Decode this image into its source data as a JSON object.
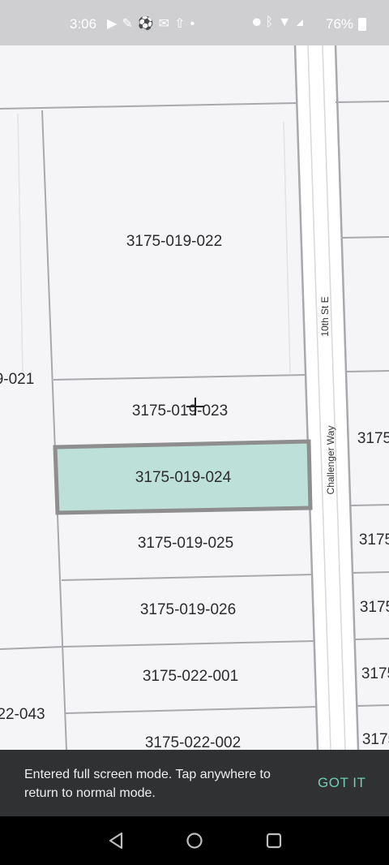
{
  "status_bar": {
    "time": "3:06",
    "left_icons": [
      "youtube-icon",
      "feed-icon",
      "game-icon",
      "mail-icon",
      "upload-icon",
      "dot-icon"
    ],
    "right_icons": [
      "location-icon",
      "bluetooth-icon",
      "wifi-icon",
      "signal-icon"
    ],
    "battery": "76%"
  },
  "map": {
    "parcels": [
      "3175-019-022",
      "3175-019-023",
      "3175-019-024",
      "3175-019-025",
      "3175-019-026",
      "3175-022-001",
      "3175-022-002"
    ],
    "partial_labels": {
      "left_upper": "9-021",
      "left_lower": "22-043",
      "right": [
        "3175",
        "3175",
        "3175",
        "3175",
        "3175"
      ]
    },
    "streets": [
      "10th St E",
      "Challenger Way"
    ],
    "selected_parcel": "3175-019-024",
    "selected_fill": "#bde0d8",
    "selected_border": "#8e8e8e"
  },
  "toast": {
    "message": "Entered full screen mode. Tap anywhere to return to normal mode.",
    "action": "GOT IT"
  },
  "nav_bar": {
    "buttons": [
      "back-icon",
      "home-icon",
      "recents-icon"
    ]
  }
}
